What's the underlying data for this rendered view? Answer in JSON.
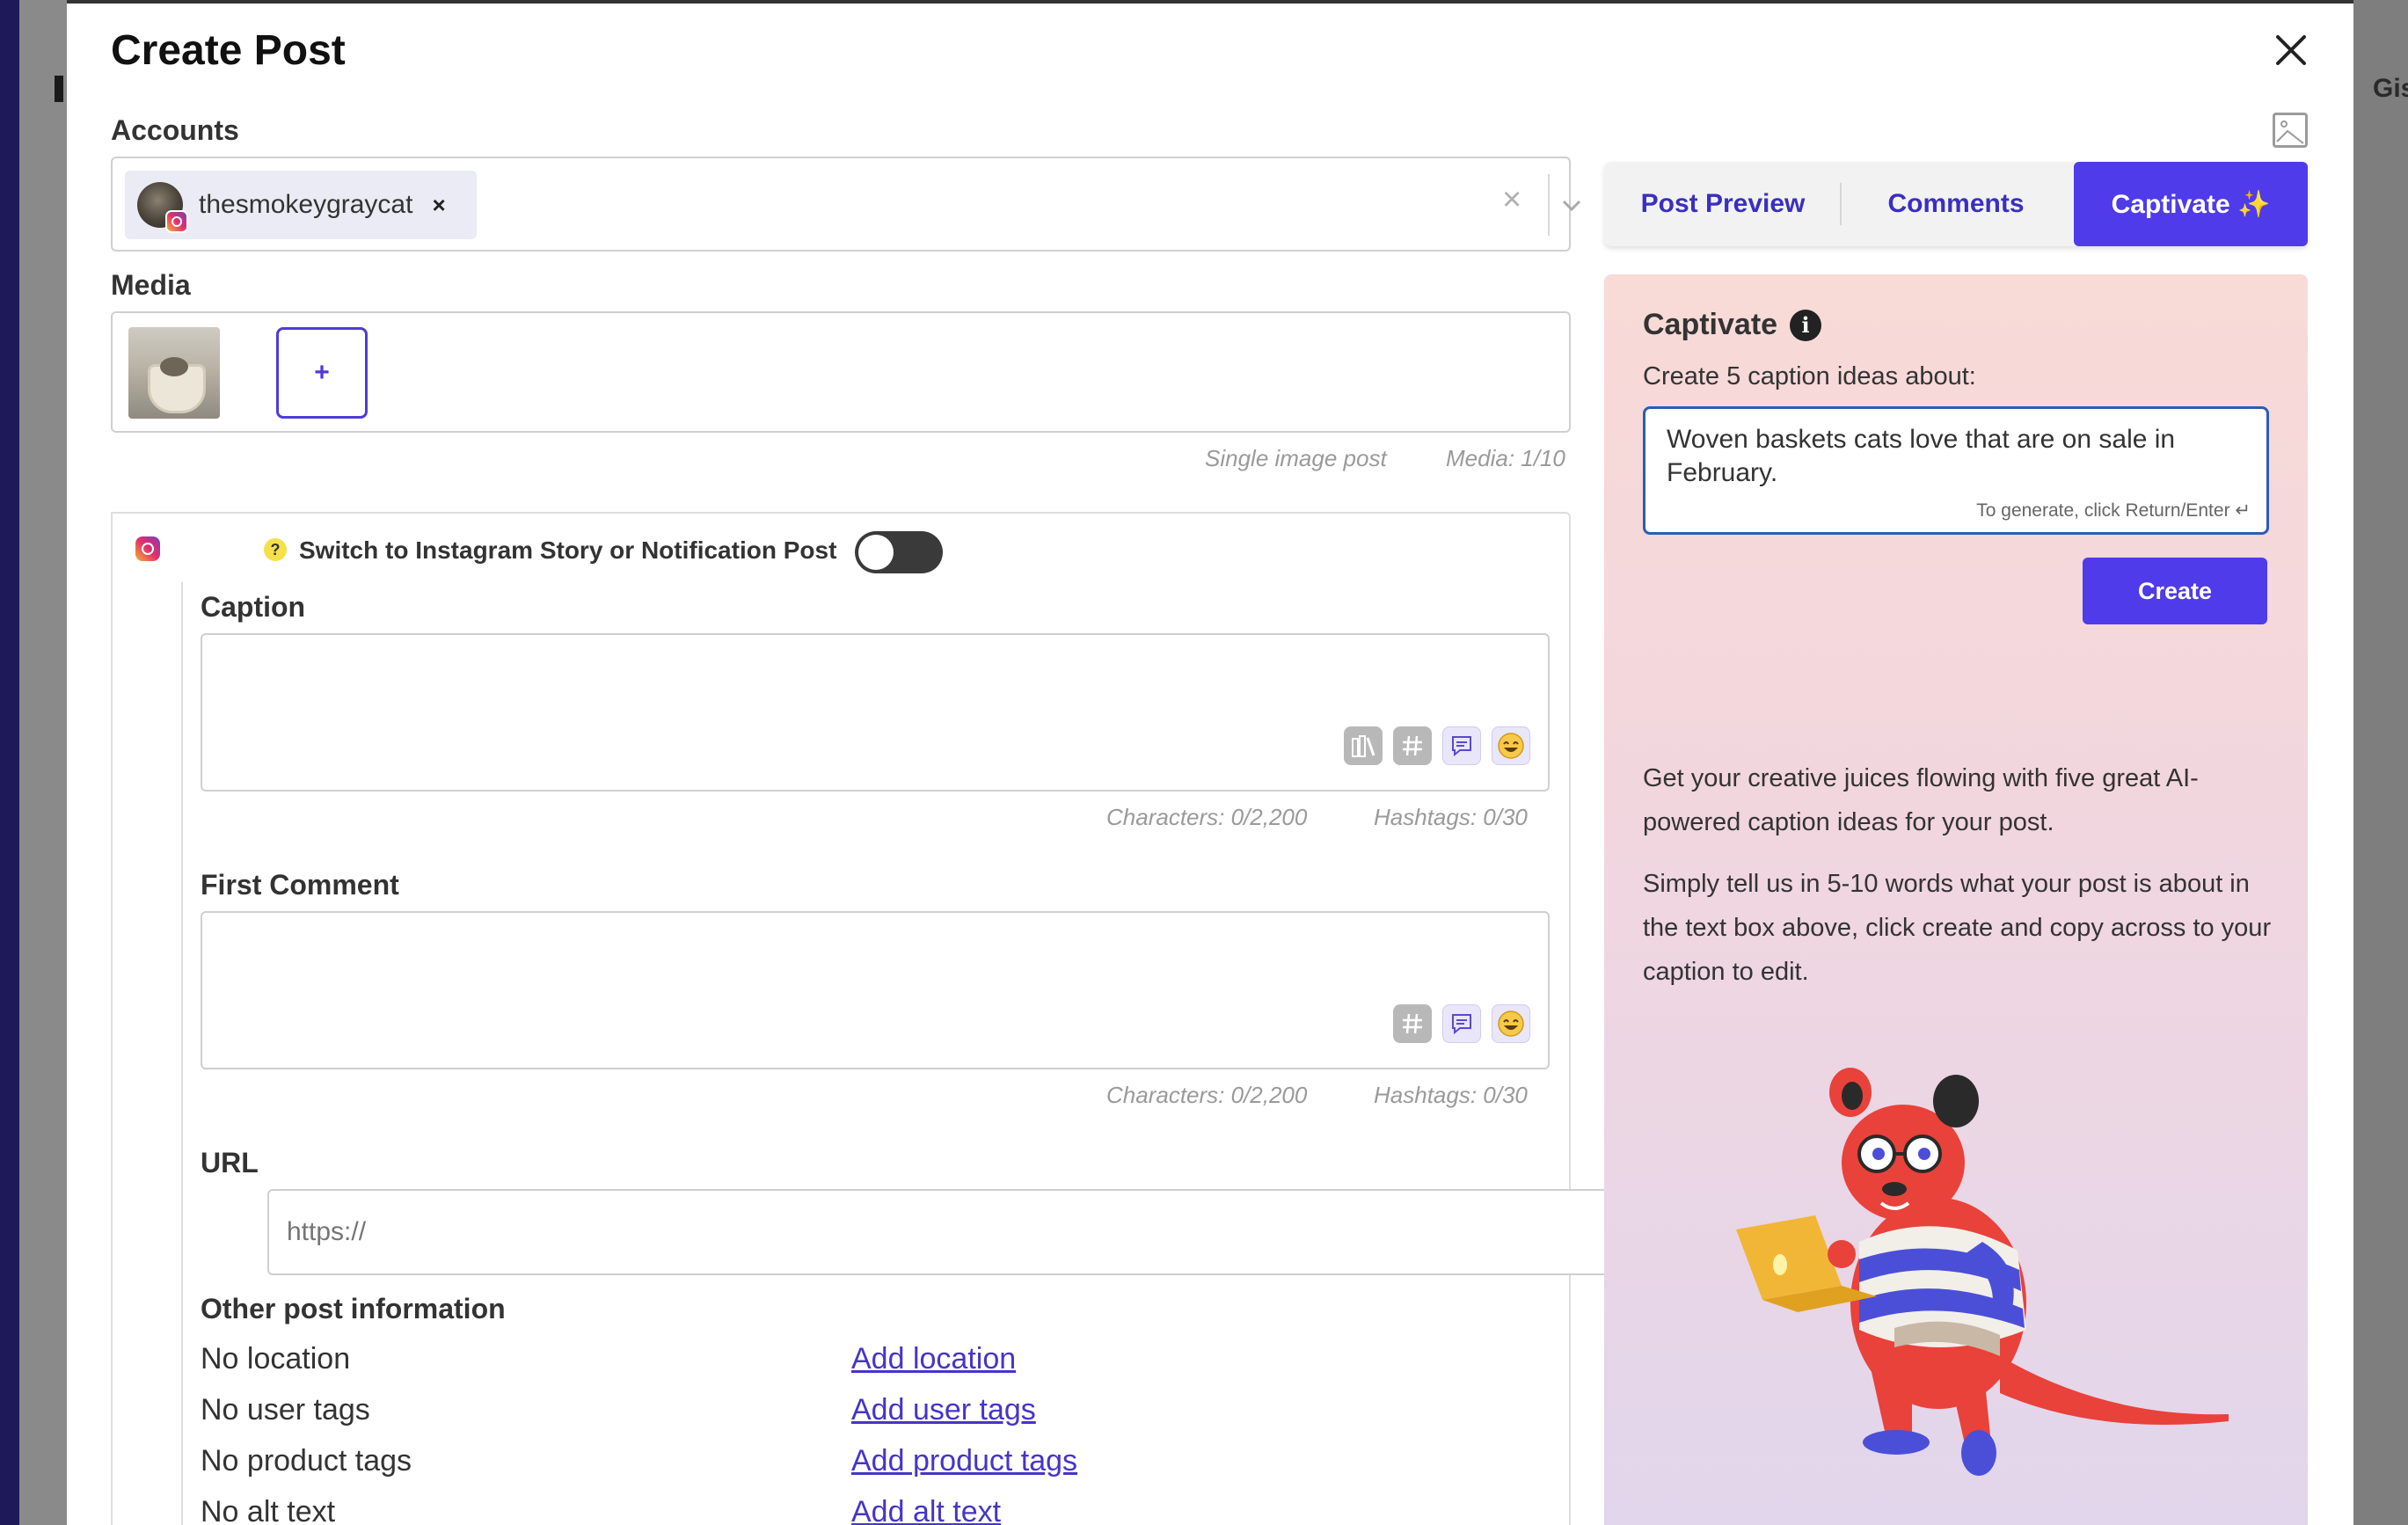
{
  "modal": {
    "title": "Create Post"
  },
  "background": {
    "right_partial_text": "Gis"
  },
  "accounts": {
    "label": "Accounts",
    "selected": [
      {
        "name": "thesmokeygraycat",
        "remove": "×"
      }
    ],
    "clear": "×"
  },
  "media": {
    "label": "Media",
    "add_label": "+",
    "post_type": "Single image post",
    "count": "Media: 1/10"
  },
  "post": {
    "help": "?",
    "switch_label": "Switch to Instagram Story or Notification Post",
    "switch_on": false,
    "caption": {
      "label": "Caption",
      "value": "",
      "characters": "Characters: 0/2,200",
      "hashtags": "Hashtags: 0/30"
    },
    "first_comment": {
      "label": "First Comment",
      "value": "",
      "characters": "Characters: 0/2,200",
      "hashtags": "Hashtags: 0/30"
    },
    "url": {
      "label": "URL",
      "placeholder": "https://"
    },
    "other_info": {
      "label": "Other post information",
      "rows": [
        {
          "status": "No location",
          "action": "Add location"
        },
        {
          "status": "No user tags",
          "action": "Add user tags"
        },
        {
          "status": "No product tags",
          "action": "Add product tags"
        },
        {
          "status": "No alt text",
          "action": "Add alt text"
        }
      ]
    }
  },
  "right_tabs": [
    {
      "label": "Post Preview",
      "active": false
    },
    {
      "label": "Comments",
      "active": false
    },
    {
      "label": "Captivate ✨",
      "active": true
    }
  ],
  "captivate": {
    "title": "Captivate",
    "info": "i",
    "prompt_label": "Create 5 caption ideas about:",
    "input_value": "Woven baskets cats love that are on sale in February.",
    "hint": "To generate, click Return/Enter ↵",
    "create_label": "Create",
    "para1": "Get your creative juices flowing with five great AI-powered caption ideas for your post.",
    "para2": "Simply tell us in 5-10 words what your post is about in the text box above, click create and copy across to your caption to edit."
  },
  "colors": {
    "accent": "#4f3bea",
    "link": "#4535c8",
    "panel_top": "#f8dad6",
    "panel_bottom": "#e2d6ec"
  }
}
